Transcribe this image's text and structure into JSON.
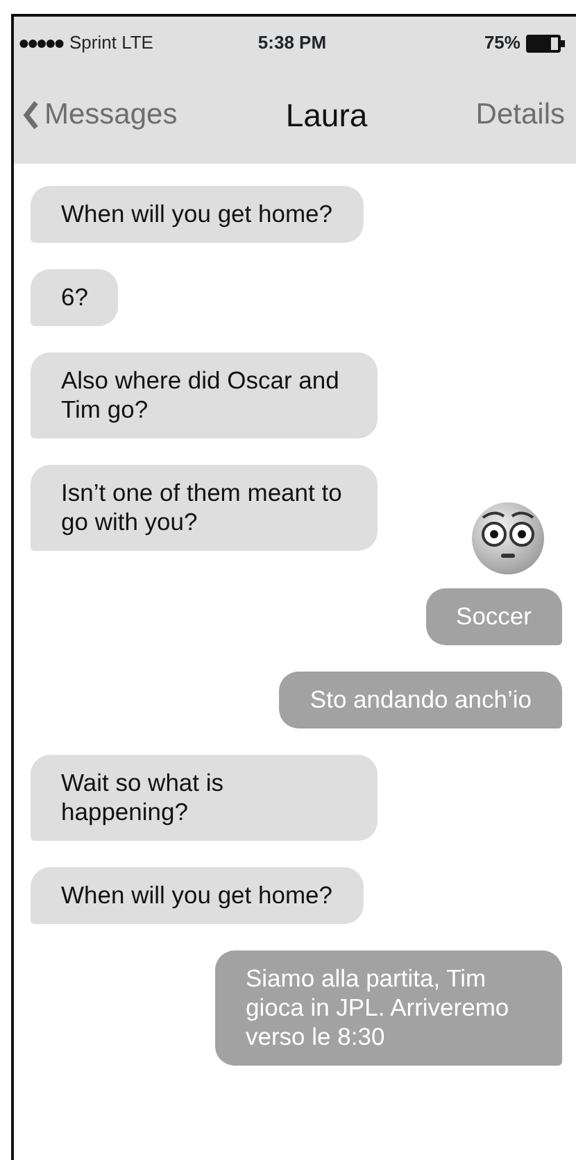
{
  "status_bar": {
    "carrier": "Sprint LTE",
    "time": "5:38 PM",
    "battery": "75%"
  },
  "nav": {
    "back": "Messages",
    "title": "Laura",
    "action": "Details"
  },
  "messages": [
    {
      "kind": "incoming",
      "text": "When will you get home?"
    },
    {
      "kind": "incoming",
      "text": "6?"
    },
    {
      "kind": "incoming",
      "text": "Also where did Oscar and Tim go?"
    },
    {
      "kind": "incoming",
      "text": "Isn’t one of them meant to go with you?"
    },
    {
      "kind": "emoji"
    },
    {
      "kind": "outgoing",
      "text": "Soccer"
    },
    {
      "kind": "outgoing",
      "text": "Sto andando anch’io"
    },
    {
      "kind": "incoming",
      "text": "Wait so what is happening?"
    },
    {
      "kind": "incoming",
      "text": "When will you get home?"
    },
    {
      "kind": "outgoing",
      "text": "Siamo alla partita, Tim gioca in JPL. Arriveremo verso le 8:30"
    }
  ]
}
